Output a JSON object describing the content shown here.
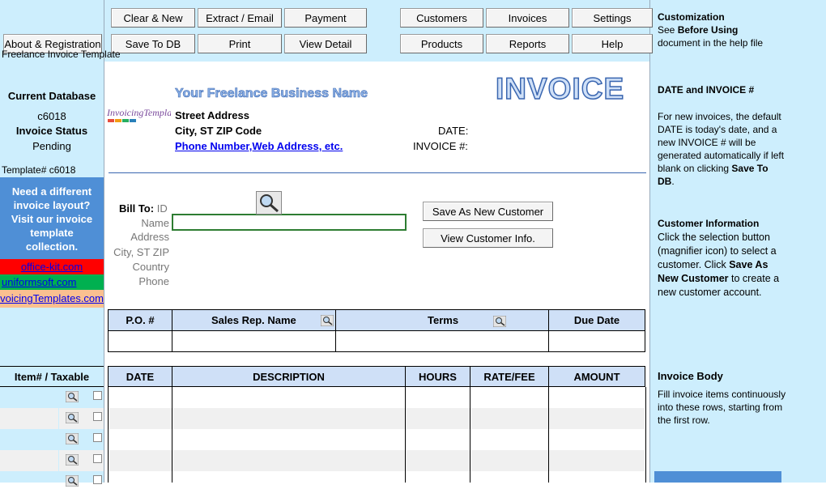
{
  "toolbar": {
    "about_label": "About & Registration",
    "clear_new": "Clear & New",
    "extract_email": "Extract / Email",
    "payment": "Payment",
    "save_to_db": "Save To DB",
    "print": "Print",
    "view_detail": "View Detail",
    "customers": "Customers",
    "invoices": "Invoices",
    "settings": "Settings",
    "products": "Products",
    "reports": "Reports",
    "help": "Help",
    "template_title": "Freelance Invoice Template"
  },
  "customization": {
    "title": "Customization",
    "line1_pre": "See ",
    "line1_bold": "Before Using",
    "line2": "document in the help file"
  },
  "left": {
    "current_database_label": "Current Database",
    "database_value": "c6018",
    "invoice_status_label": "Invoice Status",
    "status_value": "Pending",
    "template_no": "Template# c6018",
    "promo": "Need a different invoice layout? Visit our invoice template collection.",
    "link1": "office-kit.com",
    "link2": "uniformsoft.com",
    "link3": "InvoicingTemplates.com",
    "item_header": "Item# / Taxable"
  },
  "invoice": {
    "logo_text": "InvoicingTemplates",
    "business_name": "Your Freelance Business Name",
    "street": "Street Address",
    "city": "City, ST  ZIP Code",
    "phone_web": "Phone Number,Web Address, etc.",
    "title": "INVOICE",
    "date_label": "DATE:",
    "invoice_no_label": "INVOICE #:",
    "bill_to": "Bill To:",
    "id_label": "ID",
    "name_label": "Name",
    "address_label": "Address",
    "city_label": "City, ST ZIP",
    "country_label": "Country",
    "phone_label": "Phone",
    "save_new_customer": "Save As New Customer",
    "view_customer_info": "View Customer Info."
  },
  "order_table": {
    "headers": [
      "P.O. #",
      "Sales Rep. Name",
      "Terms",
      "Due Date"
    ]
  },
  "items_table": {
    "headers": [
      "DATE",
      "DESCRIPTION",
      "HOURS",
      "RATE/FEE",
      "AMOUNT"
    ]
  },
  "help": {
    "date_title": "DATE and INVOICE #",
    "date_text_1": "For new invoices, the default DATE is today's date, and a new INVOICE # will be generated automatically if left blank on clicking ",
    "date_text_bold": "Save To DB",
    "date_text_2": ".",
    "cust_title": "Customer Information",
    "cust_text_1": "Click the selection button (magnifier icon) to select a customer. Click ",
    "cust_text_bold": "Save As New Customer",
    "cust_text_2": " to create a new customer account.",
    "body_title": "Invoice Body",
    "body_text": "Fill invoice items continuously into these rows, starting from the first row."
  },
  "colors": {
    "panel_bg": "#cdeefd",
    "header_bg": "#cfe0f7",
    "promo_bg": "#4f8fd6",
    "link1_bg": "#ff0000",
    "link2_bg": "#00b050",
    "link3_bg": "#fac090",
    "link_color": "#0000ee"
  },
  "icons": {
    "magnifier": "magnifier-icon",
    "checkbox": "checkbox-icon"
  }
}
